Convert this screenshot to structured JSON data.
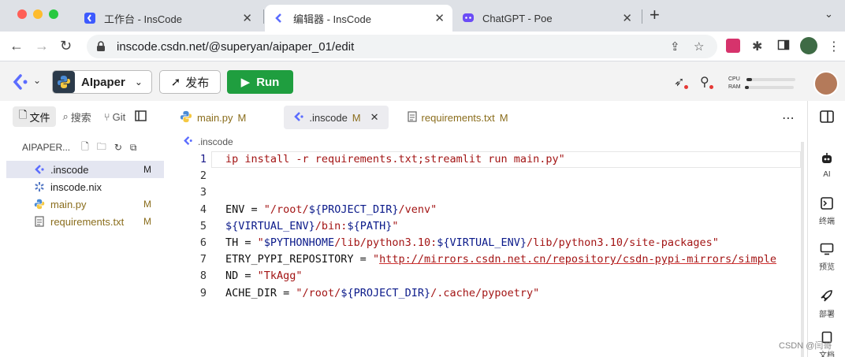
{
  "browser": {
    "tabs": [
      {
        "title": "工作台 - InsCode"
      },
      {
        "title": "编辑器 - InsCode"
      },
      {
        "title": "ChatGPT - Poe"
      }
    ],
    "url": "inscode.csdn.net/@superyan/aipaper_01/edit"
  },
  "ide": {
    "project_name": "AIpaper",
    "publish_label": "发布",
    "run_label": "Run",
    "cpu_label": "CPU",
    "ram_label": "RAM",
    "cpu_usage": 0.12,
    "ram_usage": 0.08
  },
  "sidebar": {
    "tabs": [
      {
        "label": "文件"
      },
      {
        "label": "搜索"
      },
      {
        "label": "Git"
      }
    ],
    "project_header": "AIPAPER...",
    "files": [
      {
        "name": ".inscode",
        "status": "M",
        "color": "#222222"
      },
      {
        "name": "inscode.nix",
        "status": "",
        "color": "#222222"
      },
      {
        "name": "main.py",
        "status": "M",
        "color": "#8a6d1c"
      },
      {
        "name": "requirements.txt",
        "status": "M",
        "color": "#8a6d1c"
      }
    ]
  },
  "editor": {
    "tabs": [
      {
        "name": "main.py",
        "status": "M"
      },
      {
        "name": ".inscode",
        "status": "M"
      },
      {
        "name": "requirements.txt",
        "status": "M"
      }
    ],
    "breadcrumb": ".inscode",
    "lines": [
      {
        "n": "1",
        "segs": [
          {
            "t": "ip install -r requirements.txt;streamlit run main.py\"",
            "c": "str"
          }
        ]
      },
      {
        "n": "2",
        "segs": []
      },
      {
        "n": "3",
        "segs": []
      },
      {
        "n": "4",
        "segs": [
          {
            "t": "ENV = ",
            "c": "plain"
          },
          {
            "t": "\"/root/",
            "c": "str"
          },
          {
            "t": "${PROJECT_DIR}",
            "c": "kw"
          },
          {
            "t": "/venv\"",
            "c": "str"
          }
        ]
      },
      {
        "n": "5",
        "segs": [
          {
            "t": "${VIRTUAL_ENV}",
            "c": "kw"
          },
          {
            "t": "/bin:",
            "c": "str"
          },
          {
            "t": "${PATH}",
            "c": "kw"
          },
          {
            "t": "\"",
            "c": "str"
          }
        ]
      },
      {
        "n": "6",
        "segs": [
          {
            "t": "TH = ",
            "c": "plain"
          },
          {
            "t": "\"",
            "c": "str"
          },
          {
            "t": "$PYTHONHOME",
            "c": "kw"
          },
          {
            "t": "/lib/python3.10:",
            "c": "str"
          },
          {
            "t": "${VIRTUAL_ENV}",
            "c": "kw"
          },
          {
            "t": "/lib/python3.10/site-packages\"",
            "c": "str"
          }
        ]
      },
      {
        "n": "7",
        "segs": [
          {
            "t": "ETRY_PYPI_REPOSITORY = ",
            "c": "plain"
          },
          {
            "t": "\"",
            "c": "str"
          },
          {
            "t": "http://mirrors.csdn.net.cn/repository/csdn-pypi-mirrors/simple",
            "c": "url"
          }
        ]
      },
      {
        "n": "8",
        "segs": [
          {
            "t": "ND = ",
            "c": "plain"
          },
          {
            "t": "\"TkAgg\"",
            "c": "str"
          }
        ]
      },
      {
        "n": "9",
        "segs": [
          {
            "t": "ACHE_DIR = ",
            "c": "plain"
          },
          {
            "t": "\"/root/",
            "c": "str"
          },
          {
            "t": "${PROJECT_DIR}",
            "c": "kw"
          },
          {
            "t": "/.cache/pypoetry\"",
            "c": "str"
          }
        ]
      }
    ]
  },
  "rail": {
    "items": [
      {
        "label": "AI"
      },
      {
        "label": "终端"
      },
      {
        "label": "预览"
      },
      {
        "label": "部署"
      },
      {
        "label": "文档"
      }
    ]
  },
  "watermark": "CSDN @闫哥"
}
